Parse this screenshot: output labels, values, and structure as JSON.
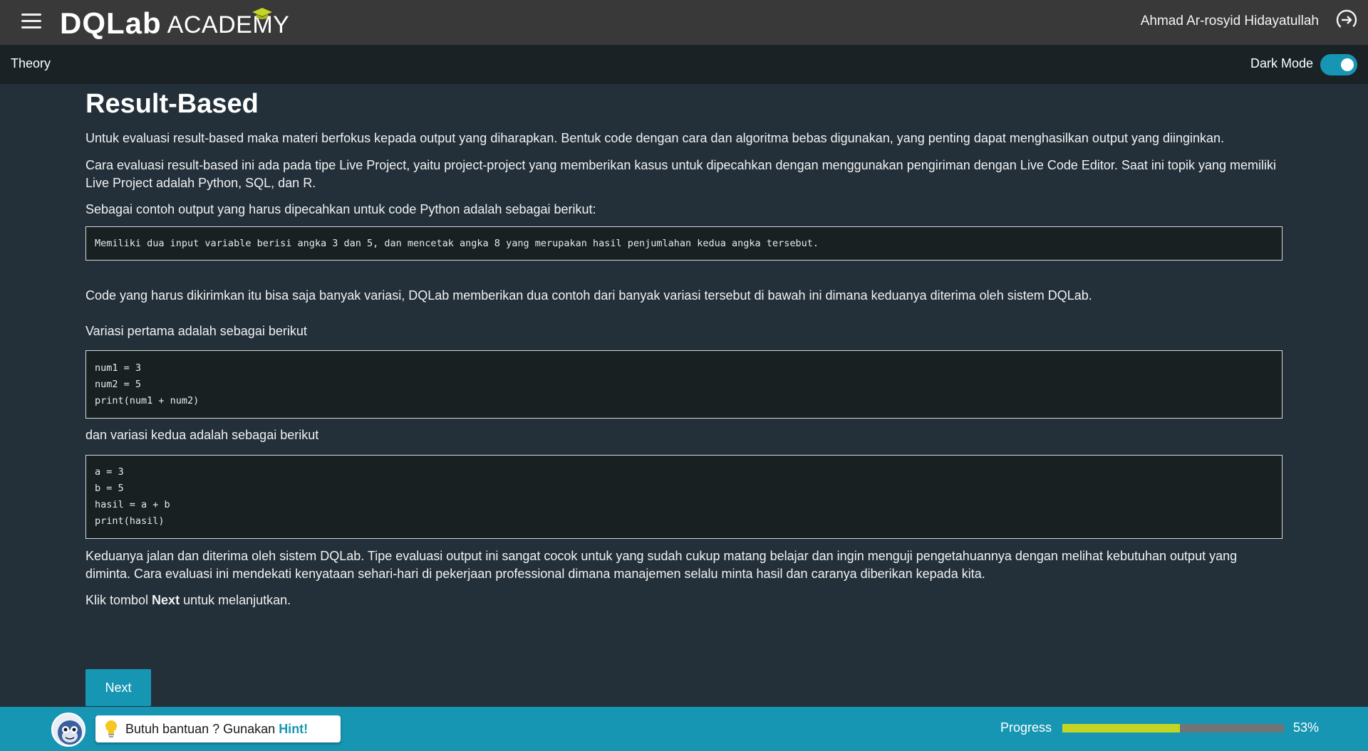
{
  "header": {
    "logo_main": "DQLab",
    "logo_sub": "ACADEMY",
    "user_name": "Ahmad Ar-rosyid Hidayatullah"
  },
  "subheader": {
    "title": "Theory",
    "dark_mode_label": "Dark Mode",
    "dark_mode_on": true
  },
  "content": {
    "title": "Result-Based",
    "p1": "Untuk evaluasi result-based maka materi berfokus kepada output yang diharapkan. Bentuk code dengan cara dan algoritma bebas digunakan, yang penting dapat menghasilkan output yang diinginkan.",
    "p2": "Cara evaluasi result-based ini ada pada tipe Live Project, yaitu project-project yang memberikan kasus untuk dipecahkan dengan menggunakan pengiriman dengan Live Code Editor. Saat ini topik yang memiliki Live Project adalah Python, SQL, dan R.",
    "p3": "Sebagai contoh output yang harus dipecahkan untuk code Python adalah sebagai berikut:",
    "code_task": "Memiliki dua input variable berisi angka 3 dan 5, dan mencetak angka 8 yang merupakan hasil penjumlahan kedua angka tersebut.",
    "p4": "Code yang harus dikirimkan itu bisa saja banyak variasi, DQLab memberikan dua contoh dari banyak variasi tersebut di bawah ini dimana keduanya diterima oleh sistem DQLab.",
    "p5": "Variasi pertama adalah sebagai berikut",
    "code1": [
      "num1 = 3",
      "num2 = 5",
      "print(num1 + num2)"
    ],
    "p6": "dan variasi kedua adalah sebagai berikut",
    "code2": [
      "a = 3",
      "b = 5",
      "hasil = a + b",
      "print(hasil)"
    ],
    "p7": "Keduanya jalan dan diterima oleh sistem DQLab. Tipe evaluasi output ini sangat cocok untuk yang sudah cukup matang belajar dan ingin menguji pengetahuannya dengan melihat kebutuhan output yang diminta. Cara evaluasi ini mendekati kenyataan sehari-hari di pekerjaan professional dimana manajemen selalu minta hasil dan caranya diberikan kepada kita.",
    "p8_before": "Klik tombol ",
    "p8_bold": "Next",
    "p8_after": " untuk melanjutkan."
  },
  "next_button": "Next",
  "footer": {
    "hint_text": "Butuh bantuan ? Gunakan",
    "hint_link": "Hint!",
    "progress_label": "Progress",
    "progress_value": 53,
    "progress_text": "53%"
  },
  "colors": {
    "accent": "#1796b4",
    "progress_fill": "#c5d524",
    "background": "#243039"
  },
  "icons": [
    "hamburger-icon",
    "logout-icon",
    "lightbulb-icon",
    "mascot-avatar",
    "graduation-cap-icon"
  ]
}
